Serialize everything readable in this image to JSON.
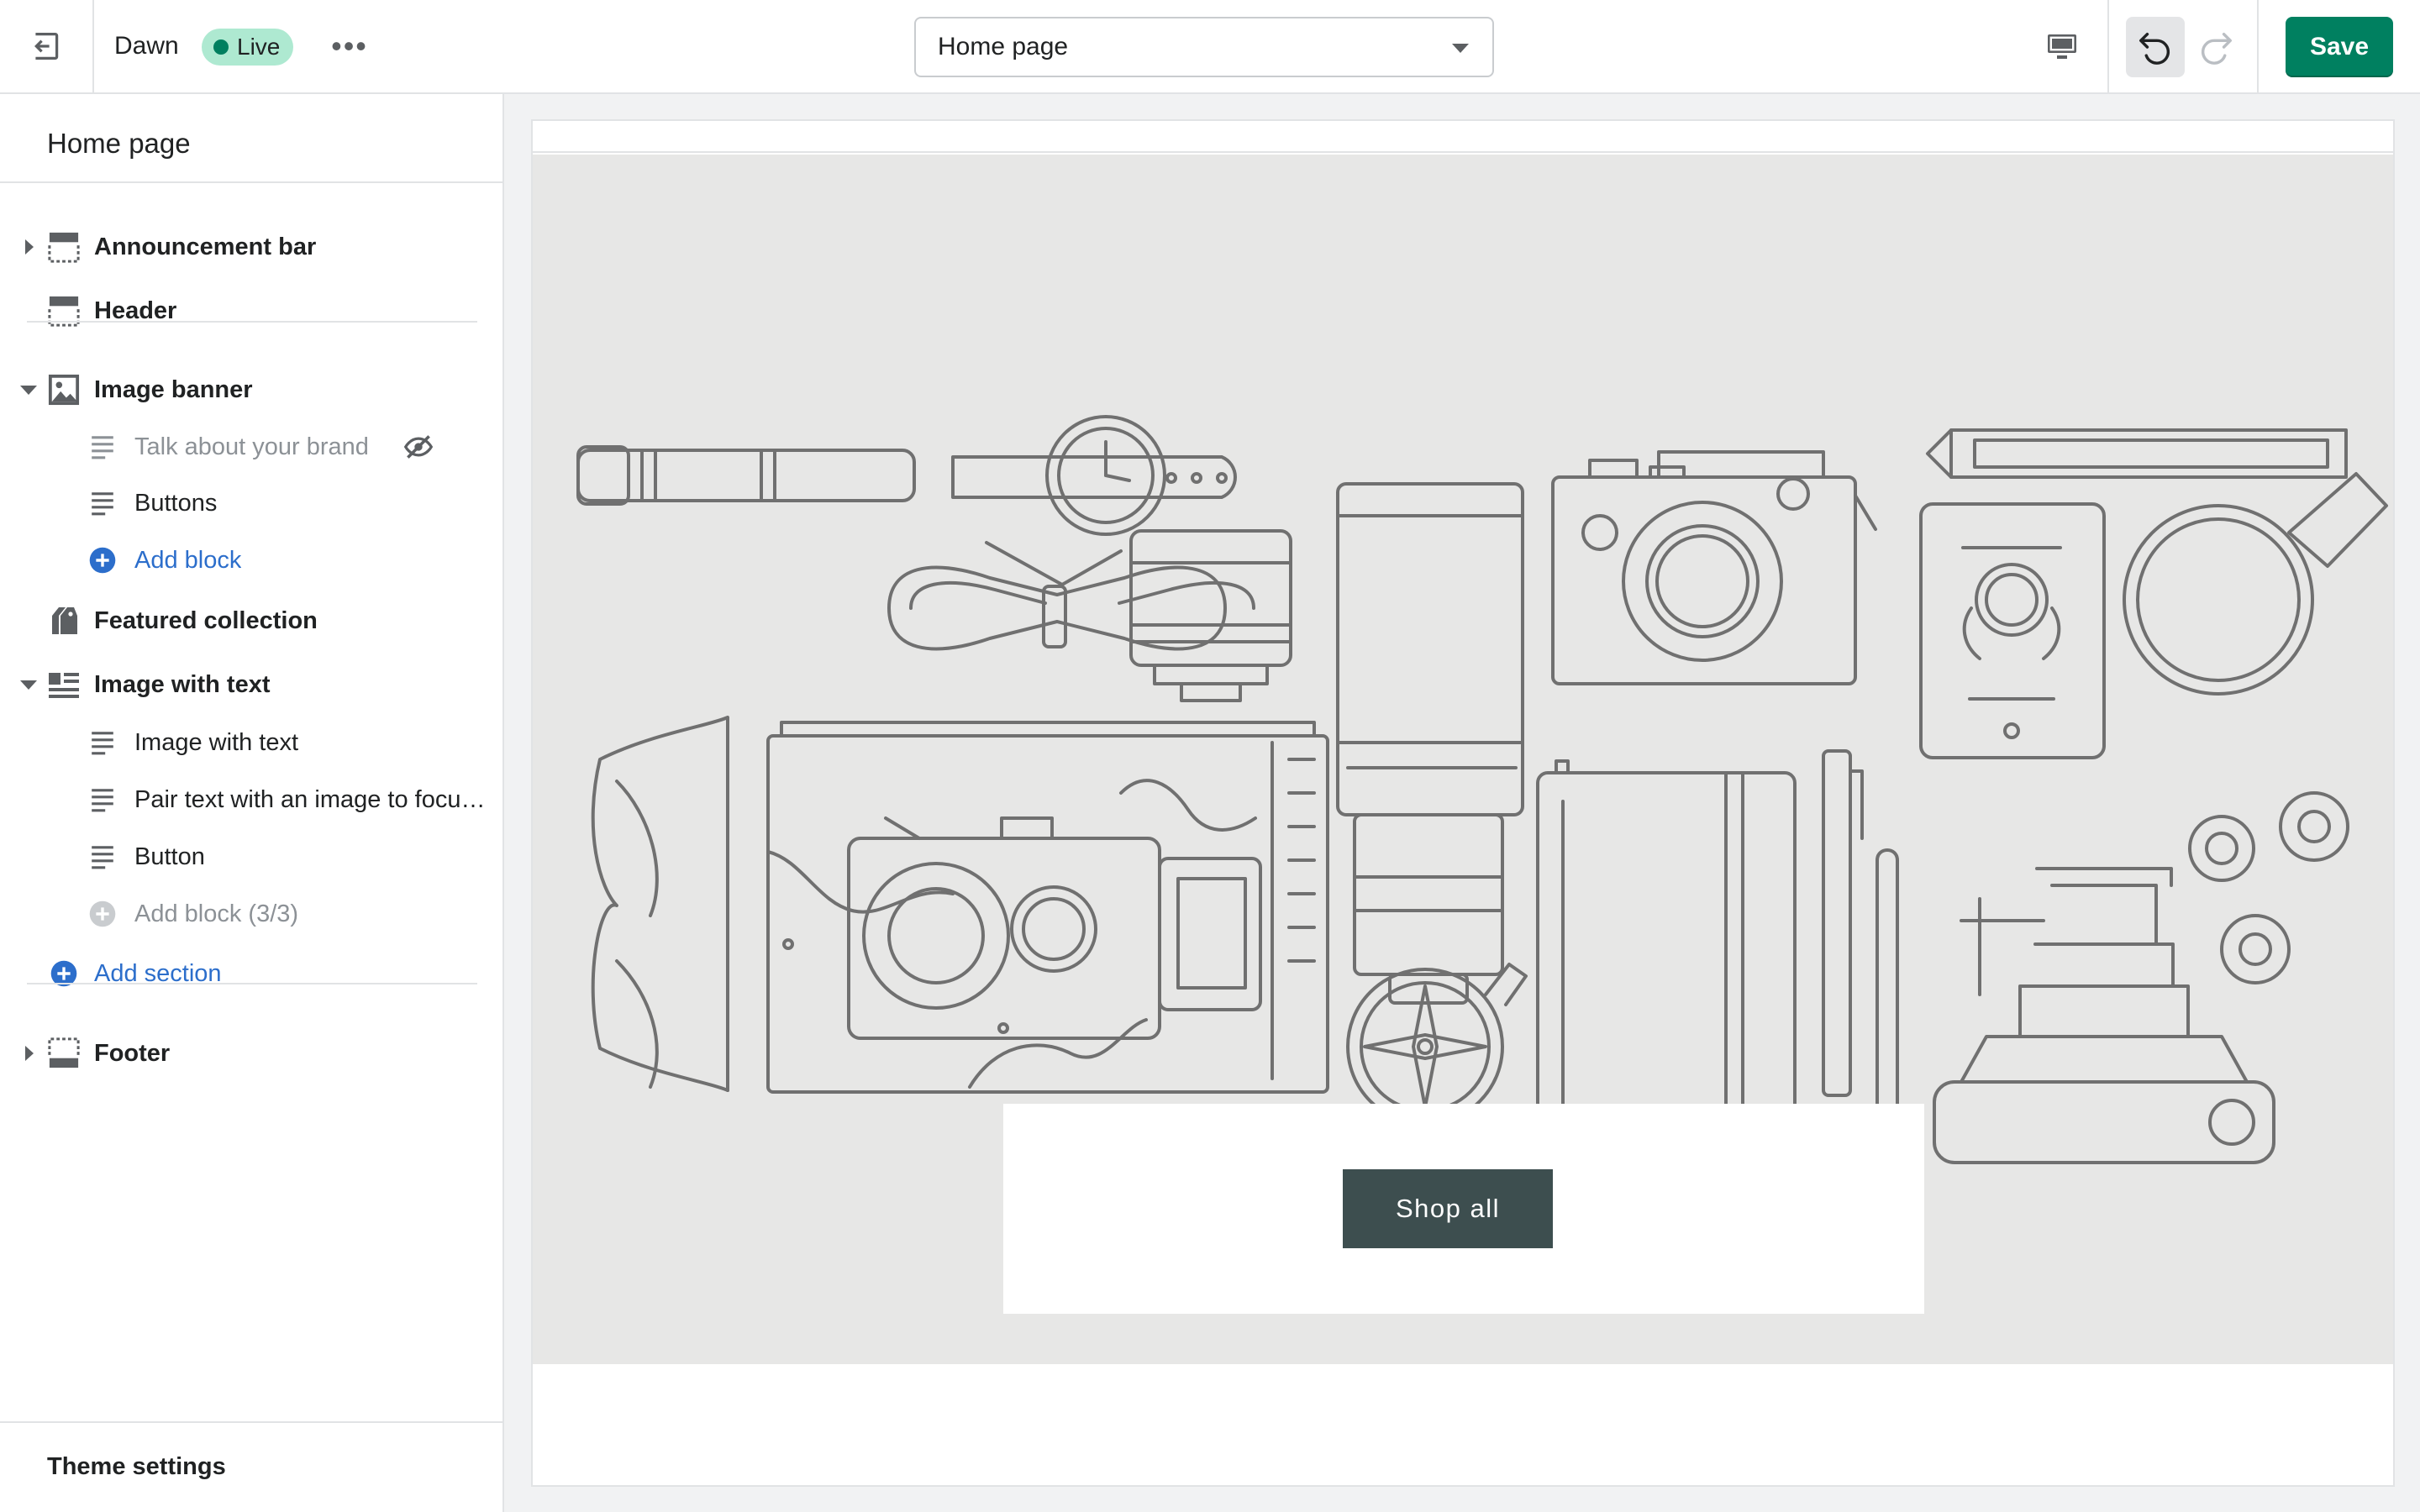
{
  "topbar": {
    "theme_name": "Dawn",
    "status_badge": "Live",
    "more_label": "•••",
    "page_selector": "Home page",
    "save_label": "Save"
  },
  "sidebar": {
    "title": "Home page",
    "sections": {
      "announcement": "Announcement bar",
      "header": "Header",
      "image_banner": "Image banner",
      "banner_block_1": "Talk about your brand",
      "banner_block_2": "Buttons",
      "banner_add_block": "Add block",
      "featured_collection": "Featured collection",
      "image_with_text": "Image with text",
      "iwt_block_1": "Image with text",
      "iwt_block_2": "Pair text with an image to focus on your chosen product, collection, or blog post",
      "iwt_block_3": "Button",
      "iwt_add_block": "Add block (3/3)",
      "add_section": "Add section",
      "footer": "Footer"
    },
    "theme_settings": "Theme settings"
  },
  "preview": {
    "button_label": "Shop all"
  },
  "colors": {
    "primary": "#008060",
    "link": "#2c6ecb",
    "badge_bg": "#aee9d1",
    "banner_bg": "#e7e7e6",
    "button_bg": "#3d4e4f"
  },
  "icons": [
    "exit-icon",
    "more-icon",
    "chevron-down-icon",
    "desktop-icon",
    "undo-icon",
    "redo-icon",
    "section-icon",
    "image-icon",
    "text-block-icon",
    "add-circle-icon",
    "hidden-eye-icon",
    "collection-icon"
  ]
}
